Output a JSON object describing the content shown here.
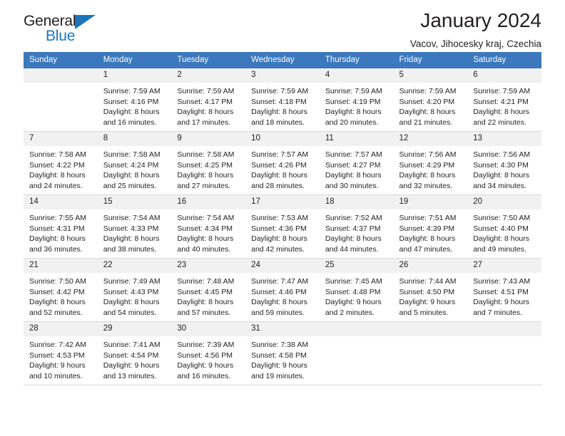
{
  "brand": {
    "word_general": "General",
    "word_blue": "Blue",
    "triangle_color": "#1b75bb"
  },
  "header": {
    "month_title": "January 2024",
    "location": "Vacov, Jihocesky kraj, Czechia"
  },
  "theme": {
    "header_blue": "#3b78bd",
    "daynum_band": "#f1f1f1",
    "cell_border": "#d9d9d9",
    "text": "#231f20"
  },
  "calendar": {
    "weekday_headers": [
      "Sunday",
      "Monday",
      "Tuesday",
      "Wednesday",
      "Thursday",
      "Friday",
      "Saturday"
    ],
    "weeks": [
      [
        {
          "day": "",
          "empty": true,
          "sunrise": "",
          "sunset": "",
          "daylight_line1": "",
          "daylight_line2": ""
        },
        {
          "day": "1",
          "empty": false,
          "sunrise": "Sunrise: 7:59 AM",
          "sunset": "Sunset: 4:16 PM",
          "daylight_line1": "Daylight: 8 hours",
          "daylight_line2": "and 16 minutes."
        },
        {
          "day": "2",
          "empty": false,
          "sunrise": "Sunrise: 7:59 AM",
          "sunset": "Sunset: 4:17 PM",
          "daylight_line1": "Daylight: 8 hours",
          "daylight_line2": "and 17 minutes."
        },
        {
          "day": "3",
          "empty": false,
          "sunrise": "Sunrise: 7:59 AM",
          "sunset": "Sunset: 4:18 PM",
          "daylight_line1": "Daylight: 8 hours",
          "daylight_line2": "and 18 minutes."
        },
        {
          "day": "4",
          "empty": false,
          "sunrise": "Sunrise: 7:59 AM",
          "sunset": "Sunset: 4:19 PM",
          "daylight_line1": "Daylight: 8 hours",
          "daylight_line2": "and 20 minutes."
        },
        {
          "day": "5",
          "empty": false,
          "sunrise": "Sunrise: 7:59 AM",
          "sunset": "Sunset: 4:20 PM",
          "daylight_line1": "Daylight: 8 hours",
          "daylight_line2": "and 21 minutes."
        },
        {
          "day": "6",
          "empty": false,
          "sunrise": "Sunrise: 7:59 AM",
          "sunset": "Sunset: 4:21 PM",
          "daylight_line1": "Daylight: 8 hours",
          "daylight_line2": "and 22 minutes."
        }
      ],
      [
        {
          "day": "7",
          "empty": false,
          "sunrise": "Sunrise: 7:58 AM",
          "sunset": "Sunset: 4:22 PM",
          "daylight_line1": "Daylight: 8 hours",
          "daylight_line2": "and 24 minutes."
        },
        {
          "day": "8",
          "empty": false,
          "sunrise": "Sunrise: 7:58 AM",
          "sunset": "Sunset: 4:24 PM",
          "daylight_line1": "Daylight: 8 hours",
          "daylight_line2": "and 25 minutes."
        },
        {
          "day": "9",
          "empty": false,
          "sunrise": "Sunrise: 7:58 AM",
          "sunset": "Sunset: 4:25 PM",
          "daylight_line1": "Daylight: 8 hours",
          "daylight_line2": "and 27 minutes."
        },
        {
          "day": "10",
          "empty": false,
          "sunrise": "Sunrise: 7:57 AM",
          "sunset": "Sunset: 4:26 PM",
          "daylight_line1": "Daylight: 8 hours",
          "daylight_line2": "and 28 minutes."
        },
        {
          "day": "11",
          "empty": false,
          "sunrise": "Sunrise: 7:57 AM",
          "sunset": "Sunset: 4:27 PM",
          "daylight_line1": "Daylight: 8 hours",
          "daylight_line2": "and 30 minutes."
        },
        {
          "day": "12",
          "empty": false,
          "sunrise": "Sunrise: 7:56 AM",
          "sunset": "Sunset: 4:29 PM",
          "daylight_line1": "Daylight: 8 hours",
          "daylight_line2": "and 32 minutes."
        },
        {
          "day": "13",
          "empty": false,
          "sunrise": "Sunrise: 7:56 AM",
          "sunset": "Sunset: 4:30 PM",
          "daylight_line1": "Daylight: 8 hours",
          "daylight_line2": "and 34 minutes."
        }
      ],
      [
        {
          "day": "14",
          "empty": false,
          "sunrise": "Sunrise: 7:55 AM",
          "sunset": "Sunset: 4:31 PM",
          "daylight_line1": "Daylight: 8 hours",
          "daylight_line2": "and 36 minutes."
        },
        {
          "day": "15",
          "empty": false,
          "sunrise": "Sunrise: 7:54 AM",
          "sunset": "Sunset: 4:33 PM",
          "daylight_line1": "Daylight: 8 hours",
          "daylight_line2": "and 38 minutes."
        },
        {
          "day": "16",
          "empty": false,
          "sunrise": "Sunrise: 7:54 AM",
          "sunset": "Sunset: 4:34 PM",
          "daylight_line1": "Daylight: 8 hours",
          "daylight_line2": "and 40 minutes."
        },
        {
          "day": "17",
          "empty": false,
          "sunrise": "Sunrise: 7:53 AM",
          "sunset": "Sunset: 4:36 PM",
          "daylight_line1": "Daylight: 8 hours",
          "daylight_line2": "and 42 minutes."
        },
        {
          "day": "18",
          "empty": false,
          "sunrise": "Sunrise: 7:52 AM",
          "sunset": "Sunset: 4:37 PM",
          "daylight_line1": "Daylight: 8 hours",
          "daylight_line2": "and 44 minutes."
        },
        {
          "day": "19",
          "empty": false,
          "sunrise": "Sunrise: 7:51 AM",
          "sunset": "Sunset: 4:39 PM",
          "daylight_line1": "Daylight: 8 hours",
          "daylight_line2": "and 47 minutes."
        },
        {
          "day": "20",
          "empty": false,
          "sunrise": "Sunrise: 7:50 AM",
          "sunset": "Sunset: 4:40 PM",
          "daylight_line1": "Daylight: 8 hours",
          "daylight_line2": "and 49 minutes."
        }
      ],
      [
        {
          "day": "21",
          "empty": false,
          "sunrise": "Sunrise: 7:50 AM",
          "sunset": "Sunset: 4:42 PM",
          "daylight_line1": "Daylight: 8 hours",
          "daylight_line2": "and 52 minutes."
        },
        {
          "day": "22",
          "empty": false,
          "sunrise": "Sunrise: 7:49 AM",
          "sunset": "Sunset: 4:43 PM",
          "daylight_line1": "Daylight: 8 hours",
          "daylight_line2": "and 54 minutes."
        },
        {
          "day": "23",
          "empty": false,
          "sunrise": "Sunrise: 7:48 AM",
          "sunset": "Sunset: 4:45 PM",
          "daylight_line1": "Daylight: 8 hours",
          "daylight_line2": "and 57 minutes."
        },
        {
          "day": "24",
          "empty": false,
          "sunrise": "Sunrise: 7:47 AM",
          "sunset": "Sunset: 4:46 PM",
          "daylight_line1": "Daylight: 8 hours",
          "daylight_line2": "and 59 minutes."
        },
        {
          "day": "25",
          "empty": false,
          "sunrise": "Sunrise: 7:45 AM",
          "sunset": "Sunset: 4:48 PM",
          "daylight_line1": "Daylight: 9 hours",
          "daylight_line2": "and 2 minutes."
        },
        {
          "day": "26",
          "empty": false,
          "sunrise": "Sunrise: 7:44 AM",
          "sunset": "Sunset: 4:50 PM",
          "daylight_line1": "Daylight: 9 hours",
          "daylight_line2": "and 5 minutes."
        },
        {
          "day": "27",
          "empty": false,
          "sunrise": "Sunrise: 7:43 AM",
          "sunset": "Sunset: 4:51 PM",
          "daylight_line1": "Daylight: 9 hours",
          "daylight_line2": "and 7 minutes."
        }
      ],
      [
        {
          "day": "28",
          "empty": false,
          "sunrise": "Sunrise: 7:42 AM",
          "sunset": "Sunset: 4:53 PM",
          "daylight_line1": "Daylight: 9 hours",
          "daylight_line2": "and 10 minutes."
        },
        {
          "day": "29",
          "empty": false,
          "sunrise": "Sunrise: 7:41 AM",
          "sunset": "Sunset: 4:54 PM",
          "daylight_line1": "Daylight: 9 hours",
          "daylight_line2": "and 13 minutes."
        },
        {
          "day": "30",
          "empty": false,
          "sunrise": "Sunrise: 7:39 AM",
          "sunset": "Sunset: 4:56 PM",
          "daylight_line1": "Daylight: 9 hours",
          "daylight_line2": "and 16 minutes."
        },
        {
          "day": "31",
          "empty": false,
          "sunrise": "Sunrise: 7:38 AM",
          "sunset": "Sunset: 4:58 PM",
          "daylight_line1": "Daylight: 9 hours",
          "daylight_line2": "and 19 minutes."
        },
        {
          "day": "",
          "empty": true,
          "sunrise": "",
          "sunset": "",
          "daylight_line1": "",
          "daylight_line2": ""
        },
        {
          "day": "",
          "empty": true,
          "sunrise": "",
          "sunset": "",
          "daylight_line1": "",
          "daylight_line2": ""
        },
        {
          "day": "",
          "empty": true,
          "sunrise": "",
          "sunset": "",
          "daylight_line1": "",
          "daylight_line2": ""
        }
      ]
    ]
  }
}
